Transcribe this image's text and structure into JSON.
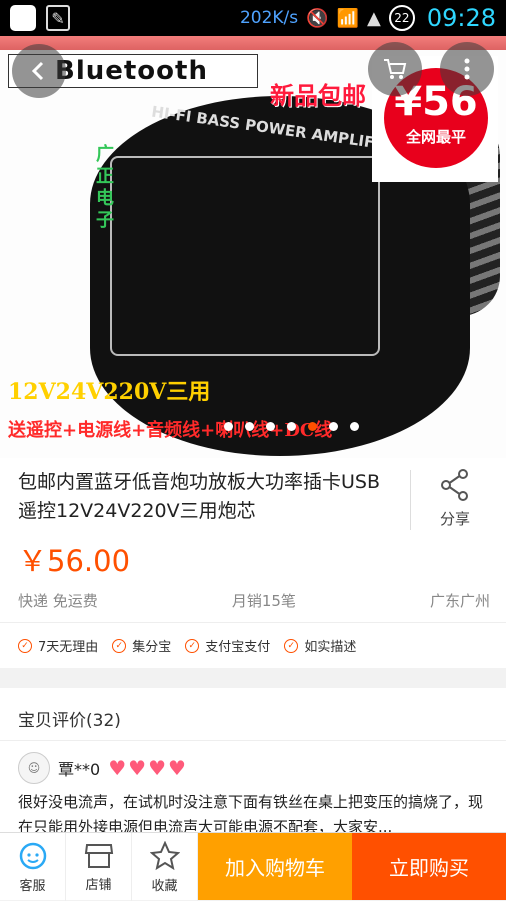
{
  "status_bar": {
    "speed": "202K/s",
    "battery": "22",
    "time": "09:28"
  },
  "hero": {
    "brand_logo": "Bluetooth",
    "board_title": "HI-FI BASS POWER AMPLIFIER M6B-F",
    "vertical_text": "广正电子",
    "promo_text": "新品包邮",
    "sticker_price": "¥56",
    "sticker_sub": "全网最平",
    "yellow_text": "12V24V220V三用",
    "red_text": "送遥控+电源线+音频线+喇叭线+DC线",
    "slide_count": 7,
    "active_slide": 4
  },
  "product": {
    "title": "包邮内置蓝牙低音炮功放板大功率插卡USB遥控12V24V220V三用炮芯",
    "share_label": "分享",
    "price": "￥56.00",
    "shipping": "快递 免运费",
    "monthly_sales": "月销15笔",
    "location": "广东广州"
  },
  "guarantees": [
    "7天无理由",
    "集分宝",
    "支付宝支付",
    "如实描述"
  ],
  "reviews": {
    "header": "宝贝评价(32)",
    "user": "覃**0",
    "rating_hearts": 4,
    "text": "很好没电流声，在试机时没注意下面有铁丝在桌上把变压的搞烧了，现在只能用外接电源但电流声大可能电源不配套，大家安..."
  },
  "bottom_bar": {
    "service": "客服",
    "shop": "店铺",
    "favorite": "收藏",
    "add_to_cart": "加入购物车",
    "buy_now": "立即购买"
  },
  "colors": {
    "accent": "#ff5000",
    "cart": "#ffa000"
  }
}
